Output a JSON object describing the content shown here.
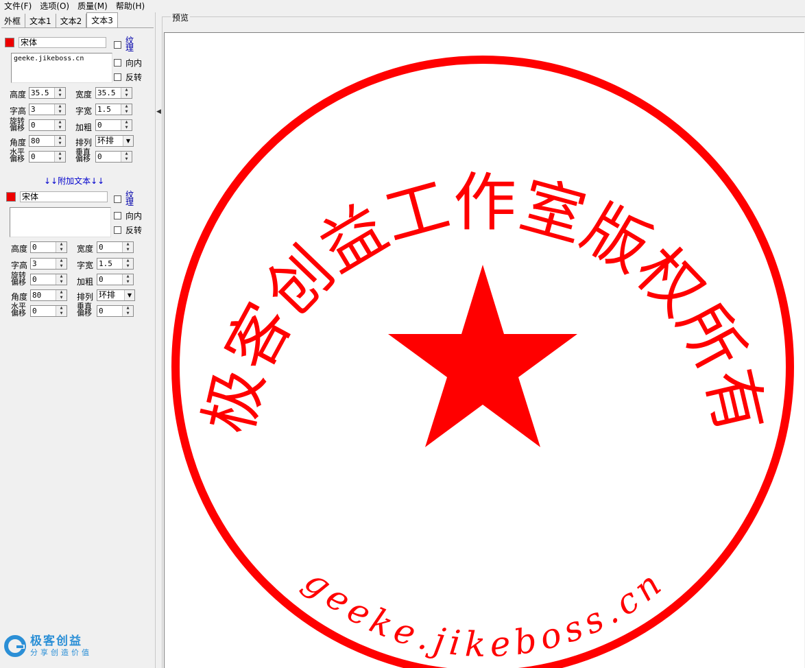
{
  "menu": [
    "文件(F)",
    "选项(O)",
    "质量(M)",
    "帮助(H)"
  ],
  "tabs": [
    "外框",
    "文本1",
    "文本2",
    "文本3"
  ],
  "active_tab": "文本3",
  "section1": {
    "color": "#ee0000",
    "font": "宋体",
    "text": "geeke.jikeboss.cn",
    "texture_label": "纹理",
    "inward_label": "向内",
    "reverse_label": "反转",
    "height_label": "高度",
    "height": "35.5",
    "width_label": "宽度",
    "width": "35.5",
    "char_height_label": "字高",
    "char_height": "3",
    "char_width_label": "字宽",
    "char_width": "1.5",
    "rotate_offset_label": "旋转偏移",
    "rotate_offset": "0",
    "bold_label": "加粗",
    "bold": "0",
    "angle_label": "角度",
    "angle": "80",
    "arrange_label": "排列",
    "arrange": "环排",
    "h_offset_label": "水平偏移",
    "h_offset": "0",
    "v_offset_label": "垂直偏移",
    "v_offset": "0"
  },
  "extra_text_label": "↓↓附加文本↓↓",
  "section2": {
    "color": "#ee0000",
    "font": "宋体",
    "text": "",
    "texture_label": "纹理",
    "inward_label": "向内",
    "reverse_label": "反转",
    "height_label": "高度",
    "height": "0",
    "width_label": "宽度",
    "width": "0",
    "char_height_label": "字高",
    "char_height": "3",
    "char_width_label": "字宽",
    "char_width": "1.5",
    "rotate_offset_label": "旋转偏移",
    "rotate_offset": "0",
    "bold_label": "加粗",
    "bold": "0",
    "angle_label": "角度",
    "angle": "80",
    "arrange_label": "排列",
    "arrange": "环排",
    "h_offset_label": "水平偏移",
    "h_offset": "0",
    "v_offset_label": "垂直偏移",
    "v_offset": "0"
  },
  "logo": {
    "title": "极客创益",
    "subtitle": "分享创造价值"
  },
  "preview": {
    "title": "预览",
    "stamp_color": "#ff0000",
    "top_text": "极客创益工作室版权所有",
    "bottom_text": "geeke.jikeboss.cn"
  }
}
